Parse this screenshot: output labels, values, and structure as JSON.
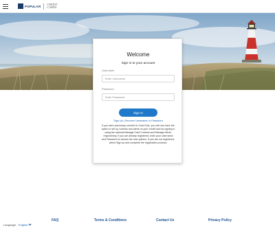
{
  "header": {
    "brand_name": "POPULAR",
    "brand_sub_line1": "CREDIT",
    "brand_sub_line2": "CARDS"
  },
  "login": {
    "title": "Welcome",
    "subtitle": "Sign in to your account",
    "username_label": "Username",
    "username_placeholder": "Enter Username",
    "password_label": "Password",
    "password_placeholder": "Enter Password",
    "signin_label": "Sign In",
    "links": {
      "signup": "Sign Up",
      "recover": "Recover Username or Password"
    },
    "notice": "If you were previously enrolled in Card Rule, you will now have the option to set up controls and alerts on your credit card by signing in using the optional Manage Card Controls and Manage Alerts, respectively. If you are already registered, enter your Username and Password to access the new options. If you are not registered, select Sign up and complete the registration process."
  },
  "footer": {
    "links": [
      "FAQ",
      "Terms & Conditions",
      "Contact Us",
      "Privacy Policy"
    ],
    "language_label": "Language:",
    "language_value": "English"
  },
  "colors": {
    "accent": "#1f78c9",
    "link": "#1a5fa8",
    "brand": "#1b3a6b"
  }
}
